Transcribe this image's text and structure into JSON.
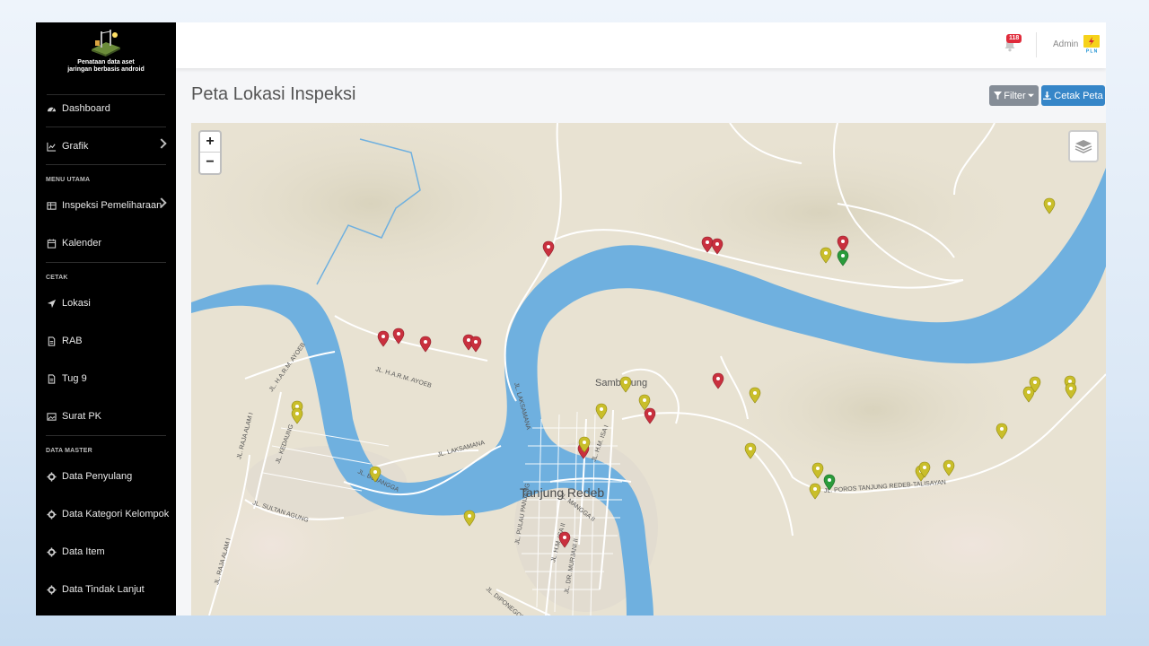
{
  "app": {
    "logo_caption": "Penataan data aset\njaringan berbasis android"
  },
  "sidebar": {
    "sections": {
      "menu_utama": "MENU UTAMA",
      "cetak": "CETAK",
      "data_master": "DATA MASTER"
    },
    "items": {
      "dashboard": "Dashboard",
      "grafik": "Grafik",
      "inspeksi": "Inspeksi Pemeliharaan",
      "kalender": "Kalender",
      "lokasi": "Lokasi",
      "rab": "RAB",
      "tug9": "Tug 9",
      "surat_pk": "Surat PK",
      "data_penyulang": "Data Penyulang",
      "data_kategori": "Data Kategori Kelompok",
      "data_item": "Data Item",
      "data_tindak_lanjut": "Data Tindak Lanjut"
    }
  },
  "topbar": {
    "notification_count": "118",
    "user_name": "Admin",
    "avatar_icon": "pln-logo-icon"
  },
  "page": {
    "title": "Peta Lokasi Inspeksi",
    "filter_label": "Filter",
    "cetak_label": "Cetak Peta"
  },
  "map": {
    "zoom_in": "+",
    "zoom_out": "−",
    "labels": {
      "sambaliung": "Sambaliung",
      "tanjung_redeb": "Tanjung Redeb",
      "jl_ayoeb": "JL. H.A.R.M. AYOEB",
      "jl_h_ar_m_ayoeb": "JL. H.A.R.M. AYOEB",
      "jl_laksamana": "JL. LAKSAMANA",
      "jl_laksamana2": "JL. LAKSAMANA",
      "jl_kedaung": "JL. KEDAUNG",
      "jl_raja_alam": "JL. RAJA ALAM I",
      "jl_raja_alam2": "JL. RAJA ALAM I",
      "jl_sultan_agung": "JL. SULTAN AGUNG",
      "jl_bujangga": "JL. BUJANGGA",
      "jl_pulau_panjang": "JL. PULAU PANJANG",
      "jl_mangga": "JL. MANGGA II",
      "jl_hm_isa": "JL. H.M. ISA II",
      "jl_hm_isa1": "JL. H.M. ISA I",
      "jl_murjani": "JL. DR. MURJANI II",
      "jl_diponegoro": "JL. DIPONEGORO",
      "jl_poros": "JL. POROS TANJUNG REDEB-TALISAYAN"
    },
    "colors": {
      "red": "#c9303e",
      "yellow": "#c9be2a",
      "green": "#2a9b3b",
      "water": "#6fb0df",
      "land": "#e8e2d2"
    }
  }
}
